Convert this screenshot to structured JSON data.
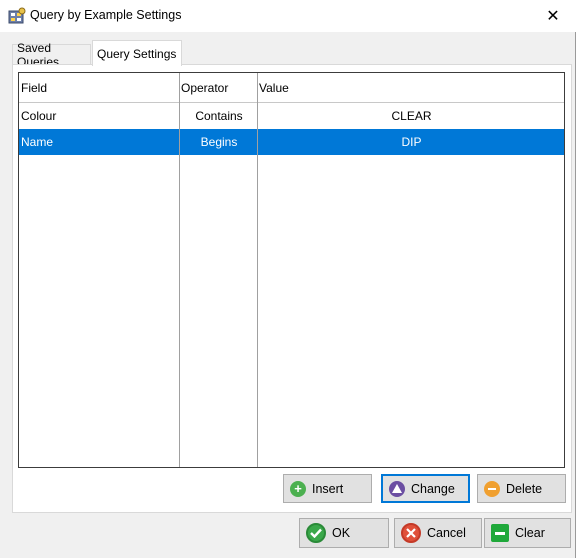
{
  "window": {
    "title": "Query by Example Settings",
    "close_glyph": "✕"
  },
  "tabs": [
    {
      "label": "Saved Queries",
      "active": false
    },
    {
      "label": "Query Settings",
      "active": true
    }
  ],
  "grid": {
    "columns": [
      "Field",
      "Operator",
      "Value"
    ],
    "rows": [
      {
        "field": "Colour",
        "operator": "Contains",
        "value": "CLEAR",
        "selected": false
      },
      {
        "field": "Name",
        "operator": "Begins",
        "value": "DIP",
        "selected": true
      }
    ]
  },
  "actions": {
    "insert": "Insert",
    "change": "Change",
    "delete": "Delete"
  },
  "footer": {
    "ok": "OK",
    "cancel": "Cancel",
    "clear": "Clear"
  },
  "icons": {
    "app": "query-app-icon",
    "insert": "plus-circle-icon",
    "change": "triangle-up-circle-icon",
    "delete": "minus-circle-icon",
    "ok": "checkmark-circle-icon",
    "cancel": "x-circle-icon",
    "clear": "minus-square-icon"
  },
  "colors": {
    "selection": "#0078d7",
    "focus_border": "#0078d7"
  }
}
